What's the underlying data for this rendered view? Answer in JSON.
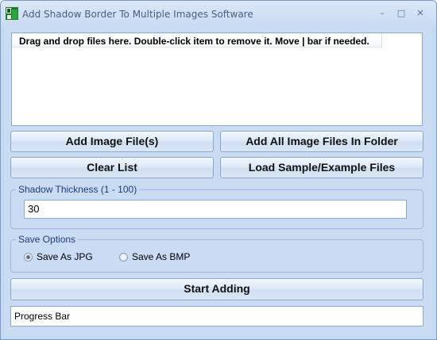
{
  "window": {
    "title": "Add Shadow Border To Multiple Images Software",
    "minimize_glyph": "–",
    "maximize_glyph": "□",
    "close_glyph": "✕"
  },
  "file_list": {
    "header": "Drag and drop files here. Double-click item to remove it. Move | bar if needed.",
    "items": []
  },
  "buttons": {
    "add_image_files": "Add Image File(s)",
    "add_all_in_folder": "Add All Image Files In Folder",
    "clear_list": "Clear List",
    "load_sample": "Load Sample/Example Files",
    "start_adding": "Start Adding"
  },
  "shadow": {
    "legend": "Shadow Thickness (1 - 100)",
    "value": "30"
  },
  "save_options": {
    "legend": "Save Options",
    "options": [
      {
        "label": "Save As JPG",
        "checked": true
      },
      {
        "label": "Save As BMP",
        "checked": false
      }
    ]
  },
  "progress": {
    "label": "Progress Bar"
  },
  "colors": {
    "background": "#c9dcf4",
    "legend_text": "#1f3d78"
  }
}
